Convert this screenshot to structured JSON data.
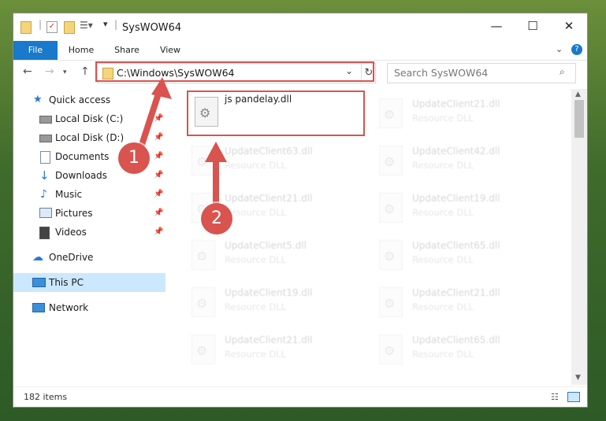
{
  "window": {
    "title": "SysWOW64",
    "controls": {
      "minimize": "—",
      "maximize": "☐",
      "close": "✕"
    }
  },
  "ribbon": {
    "tabs": [
      "File",
      "Home",
      "Share",
      "View"
    ],
    "expand_icon": "chevron-down-icon",
    "help_icon": "help-icon"
  },
  "address": {
    "path": "C:\\Windows\\SysWOW64",
    "search_placeholder": "Search SysWOW64"
  },
  "nav": {
    "items": [
      {
        "label": "Quick access",
        "icon": "star-icon",
        "pinned": false
      },
      {
        "label": "Local Disk (C:)",
        "icon": "drive-icon",
        "pinned": true
      },
      {
        "label": "Local Disk (D:)",
        "icon": "drive-icon",
        "pinned": true
      },
      {
        "label": "Documents",
        "icon": "document-icon",
        "pinned": true
      },
      {
        "label": "Downloads",
        "icon": "download-icon",
        "pinned": true
      },
      {
        "label": "Music",
        "icon": "music-icon",
        "pinned": true
      },
      {
        "label": "Pictures",
        "icon": "pictures-icon",
        "pinned": true
      },
      {
        "label": "Videos",
        "icon": "video-icon",
        "pinned": true
      },
      {
        "label": "OneDrive",
        "icon": "cloud-icon",
        "pinned": false
      },
      {
        "label": "This PC",
        "icon": "computer-icon",
        "pinned": false,
        "selected": true
      },
      {
        "label": "Network",
        "icon": "network-icon",
        "pinned": false
      }
    ]
  },
  "files": {
    "highlighted": {
      "name": "js pandelay.dll"
    },
    "faded": [
      {
        "name": "UpdateClient21.dll",
        "type": "Resource DLL"
      },
      {
        "name": "UpdateClient63.dll",
        "type": "Resource DLL"
      },
      {
        "name": "UpdateClient42.dll",
        "type": "Resource DLL"
      },
      {
        "name": "UpdateClient21.dll",
        "type": "Resource DLL"
      },
      {
        "name": "UpdateClient19.dll",
        "type": "Resource DLL"
      },
      {
        "name": "UpdateClient5.dll",
        "type": "Resource DLL"
      },
      {
        "name": "UpdateClient65.dll",
        "type": "Resource DLL"
      },
      {
        "name": "UpdateClient19.dll",
        "type": "Resource DLL"
      },
      {
        "name": "UpdateClient21.dll",
        "type": "Resource DLL"
      },
      {
        "name": "UpdateClient21.dll",
        "type": "Resource DLL"
      },
      {
        "name": "UpdateClient65.dll",
        "type": "Resource DLL"
      }
    ]
  },
  "status": {
    "item_count": "182 items"
  },
  "annotations": {
    "callout_1": "1",
    "callout_2": "2",
    "color": "#d9534f"
  }
}
